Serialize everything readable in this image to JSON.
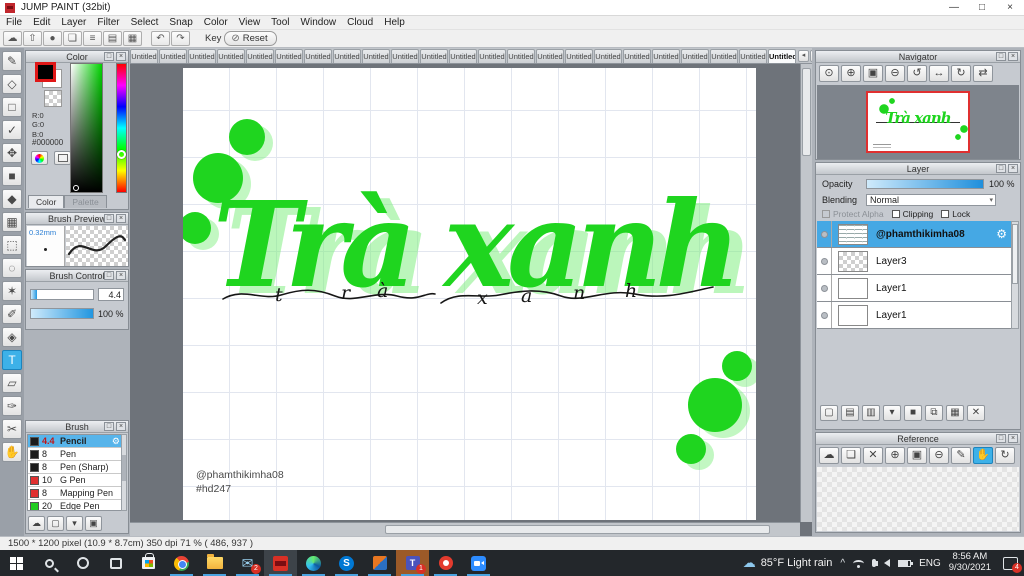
{
  "window": {
    "title": "JUMP PAINT (32bit)",
    "minimize": "—",
    "maximize": "□",
    "close": "×"
  },
  "menu": {
    "items": [
      "File",
      "Edit",
      "Layer",
      "Filter",
      "Select",
      "Snap",
      "Color",
      "View",
      "Tool",
      "Window",
      "Cloud",
      "Help"
    ]
  },
  "toolbar": {
    "buttons": [
      {
        "name": "cloud-icon",
        "glyph": "☁"
      },
      {
        "name": "export-icon",
        "glyph": "⇧"
      },
      {
        "name": "balloon-icon",
        "glyph": "●"
      },
      {
        "name": "comment-icon",
        "glyph": "❏"
      },
      {
        "name": "document-icon",
        "glyph": "≡"
      },
      {
        "name": "panel-layout-icon",
        "glyph": "▤"
      },
      {
        "name": "color-grid-icon",
        "glyph": "▦"
      }
    ],
    "undo_glyph": "↶",
    "redo_glyph": "↷",
    "key_label": "Key",
    "reset_label": "Reset",
    "reset_glyph": "⊘"
  },
  "tools": {
    "items": [
      {
        "name": "pen-tool",
        "glyph": "✎"
      },
      {
        "name": "eraser-tool",
        "glyph": "◇"
      },
      {
        "name": "shape-brush-tool",
        "glyph": "□"
      },
      {
        "name": "dot-pen-tool",
        "glyph": "✓"
      },
      {
        "name": "move-tool",
        "glyph": "✥"
      },
      {
        "name": "fill-rect-tool",
        "glyph": "■"
      },
      {
        "name": "bucket-tool",
        "glyph": "◆"
      },
      {
        "name": "gradient-tool",
        "glyph": "▦"
      },
      {
        "name": "select-rect-tool",
        "glyph": "⬚"
      },
      {
        "name": "lasso-tool",
        "glyph": "◌"
      },
      {
        "name": "magic-wand-tool",
        "glyph": "✶"
      },
      {
        "name": "select-pen-tool",
        "glyph": "✐"
      },
      {
        "name": "select-eraser-tool",
        "glyph": "◈"
      },
      {
        "name": "text-tool",
        "glyph": "T",
        "active": true
      },
      {
        "name": "object-tool",
        "glyph": "▱"
      },
      {
        "name": "eyedropper-tool",
        "glyph": "✑"
      },
      {
        "name": "divide-tool",
        "glyph": "✂"
      },
      {
        "name": "hand-tool",
        "glyph": "✋"
      }
    ]
  },
  "color_panel": {
    "title": "Color",
    "r": "R:0",
    "g": "G:0",
    "b": "B:0",
    "hex": "#000000",
    "tab_color": "Color",
    "tab_palette": "Palette"
  },
  "brush_preview": {
    "title": "Brush Preview",
    "size_label": "0.32mm"
  },
  "brush_control": {
    "title": "Brush Control",
    "size_value": "4.4",
    "opacity_value": "100 %"
  },
  "brush_panel": {
    "title": "Brush",
    "gear_glyph": "⚙",
    "brushes": [
      {
        "size": "4.4",
        "name": "Pencil",
        "swatch": "#1c1c1c",
        "selected": true
      },
      {
        "size": "8",
        "name": "Pen",
        "swatch": "#1c1c1c"
      },
      {
        "size": "8",
        "name": "Pen (Sharp)",
        "swatch": "#1c1c1c"
      },
      {
        "size": "10",
        "name": "G Pen",
        "swatch": "#e03030"
      },
      {
        "size": "8",
        "name": "Mapping Pen",
        "swatch": "#e03030"
      },
      {
        "size": "20",
        "name": "Edge Pen",
        "swatch": "#22cc22"
      }
    ],
    "buttons": [
      {
        "name": "cloud-download-icon",
        "glyph": "☁"
      },
      {
        "name": "new-brush-icon",
        "glyph": "▢"
      },
      {
        "name": "save-brush-icon",
        "glyph": "▾"
      },
      {
        "name": "brush-script-icon",
        "glyph": "▣"
      }
    ]
  },
  "tabs": {
    "label": "Untitled",
    "count": 23,
    "active_index": 22,
    "left_arrow": "◂",
    "right_arrow": "▸"
  },
  "canvas": {
    "artwork_text": "Trà xanh",
    "script_letters": [
      "t",
      "r",
      "à",
      "x",
      "a",
      "n",
      "h"
    ],
    "credit_line1": "@phamthikimha08",
    "credit_line2": "#hd247",
    "green": "#1fd51f"
  },
  "navigator": {
    "title": "Navigator",
    "thumb_text": "Trà xanh",
    "buttons": [
      {
        "name": "zoom-tool-icon",
        "glyph": "⊙"
      },
      {
        "name": "zoom-in-icon",
        "glyph": "⊕"
      },
      {
        "name": "fit-screen-icon",
        "glyph": "▣"
      },
      {
        "name": "zoom-out-icon",
        "glyph": "⊖"
      },
      {
        "name": "rotate-ccw-icon",
        "glyph": "↺"
      },
      {
        "name": "reset-view-icon",
        "glyph": "↔"
      },
      {
        "name": "rotate-cw-icon",
        "glyph": "↻"
      },
      {
        "name": "flip-icon",
        "glyph": "⇄"
      }
    ]
  },
  "layer_panel": {
    "title": "Layer",
    "opacity_label": "Opacity",
    "opacity_value": "100 %",
    "blending_label": "Blending",
    "blending_value": "Normal",
    "check_protect": "Protect Alpha",
    "check_clipping": "Clipping",
    "check_lock": "Lock",
    "gear_glyph": "⚙",
    "layers": [
      {
        "name": "@phamthikimha08",
        "selected": true
      },
      {
        "name": "Layer3"
      },
      {
        "name": "Layer1"
      },
      {
        "name": "Layer1"
      }
    ],
    "buttons": [
      {
        "name": "add-layer-icon",
        "glyph": "▢"
      },
      {
        "name": "add-halftone-layer-icon",
        "glyph": "▤"
      },
      {
        "name": "add-1bit-layer-icon",
        "glyph": "▥"
      },
      {
        "name": "layer-menu-dropdown-icon",
        "glyph": "▾"
      },
      {
        "name": "layer-folder-icon",
        "glyph": "■"
      },
      {
        "name": "duplicate-layer-icon",
        "glyph": "⧉"
      },
      {
        "name": "merge-layer-icon",
        "glyph": "▦"
      },
      {
        "name": "delete-layer-icon",
        "glyph": "✕"
      }
    ]
  },
  "reference_panel": {
    "title": "Reference",
    "buttons": [
      {
        "name": "cloud-icon",
        "glyph": "☁"
      },
      {
        "name": "open-folder-icon",
        "glyph": "❏"
      },
      {
        "name": "close-ref-icon",
        "glyph": "✕"
      },
      {
        "name": "zoom-in-icon",
        "glyph": "⊕"
      },
      {
        "name": "fit-screen-icon",
        "glyph": "▣"
      },
      {
        "name": "zoom-out-icon",
        "glyph": "⊖"
      },
      {
        "name": "pencil-icon",
        "glyph": "✎"
      },
      {
        "name": "hand-icon",
        "glyph": "✋",
        "active": true
      },
      {
        "name": "rotate-icon",
        "glyph": "↻"
      }
    ]
  },
  "panel_chrome": {
    "popout_glyph": "□",
    "close_glyph": "×"
  },
  "status_bar": {
    "text": "1500 * 1200 pixel   (10.9 * 8.7cm)   350 dpi   71 %   ( 486, 937 )"
  },
  "taskbar": {
    "apps": [
      {
        "name": "start",
        "type": "start"
      },
      {
        "name": "search",
        "type": "search"
      },
      {
        "name": "cortana",
        "type": "cortana"
      },
      {
        "name": "task-view",
        "type": "taskview"
      },
      {
        "name": "store",
        "type": "store"
      },
      {
        "name": "chrome",
        "type": "chrome",
        "active": true
      },
      {
        "name": "file-explorer",
        "type": "explorer",
        "active": true
      },
      {
        "name": "mail",
        "type": "mail",
        "active": true,
        "badge": "2",
        "label": "✉"
      },
      {
        "name": "jump-paint",
        "type": "jump",
        "active": true,
        "highlight": "gray"
      },
      {
        "name": "edge",
        "type": "edge",
        "active": true
      },
      {
        "name": "skype",
        "type": "skype",
        "active": true,
        "label": "S"
      },
      {
        "name": "paint-tool",
        "type": "sai",
        "active": true
      },
      {
        "name": "teams",
        "type": "teams",
        "active": true,
        "highlight": "orange",
        "badge": "1",
        "label": "T"
      },
      {
        "name": "meet",
        "type": "meet",
        "active": true
      },
      {
        "name": "zoom-app",
        "type": "zoom",
        "active": true
      }
    ],
    "weather": "85°F Light rain",
    "cloud_glyph": "☁",
    "chevron": "^",
    "language": "ENG",
    "time": "8:56 AM",
    "date": "9/30/2021",
    "notification_badge": "4"
  }
}
